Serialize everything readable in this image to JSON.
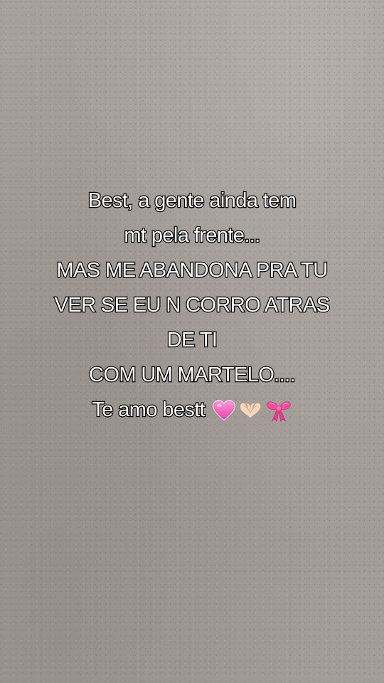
{
  "caption": {
    "lines": [
      "Best, a gente ainda tem",
      "mt pela frente...",
      "MAS ME ABANDONA PRA TU",
      "VER SE EU N CORRO ATRAS",
      "DE TI",
      "COM UM MARTELO....",
      "Te amo bestt"
    ],
    "emojis": [
      "pink-heart-icon",
      "heart-hands-icon",
      "ribbon-bow-icon"
    ]
  },
  "colors": {
    "background": "#a39c97",
    "text": "#ffffff",
    "outline": "#000000"
  }
}
